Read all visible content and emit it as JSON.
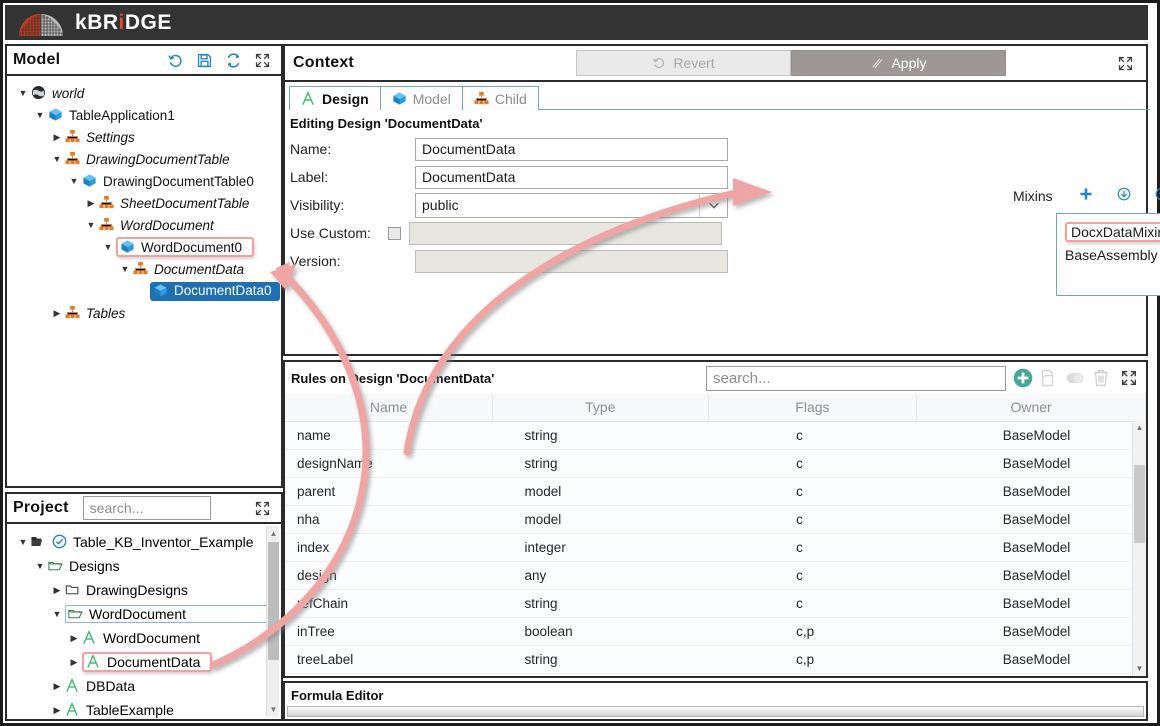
{
  "app": {
    "logo_text_1": "k",
    "logo_text_2": "BR",
    "logo_dot": "i",
    "logo_text_3": "DGE"
  },
  "model_panel": {
    "title": "Model",
    "icons": [
      "history-icon",
      "save-icon",
      "refresh-icon",
      "maximize-icon"
    ],
    "tree": [
      {
        "label": "world",
        "depth": 0,
        "twisty": "down",
        "icon": "globe-icon",
        "style": "italic",
        "state": "none"
      },
      {
        "label": "TableApplication1",
        "depth": 1,
        "twisty": "down",
        "icon": "cube-icon",
        "style": "normal",
        "state": "none"
      },
      {
        "label": "Settings",
        "depth": 2,
        "twisty": "right",
        "icon": "hierarchy-icon",
        "style": "italic",
        "state": "none"
      },
      {
        "label": "DrawingDocumentTable",
        "depth": 2,
        "twisty": "down",
        "icon": "hierarchy-icon",
        "style": "italic",
        "state": "none"
      },
      {
        "label": "DrawingDocumentTable0",
        "depth": 3,
        "twisty": "down",
        "icon": "cube-icon",
        "style": "normal",
        "state": "none"
      },
      {
        "label": "SheetDocumentTable",
        "depth": 4,
        "twisty": "right",
        "icon": "hierarchy-icon",
        "style": "italic",
        "state": "none"
      },
      {
        "label": "WordDocument",
        "depth": 4,
        "twisty": "down",
        "icon": "hierarchy-icon",
        "style": "italic",
        "state": "none"
      },
      {
        "label": "WordDocument0",
        "depth": 5,
        "twisty": "down",
        "icon": "cube-icon",
        "style": "normal",
        "state": "highlight-red"
      },
      {
        "label": "DocumentData",
        "depth": 6,
        "twisty": "down",
        "icon": "hierarchy-icon",
        "style": "italic",
        "state": "none"
      },
      {
        "label": "DocumentData0",
        "depth": 7,
        "twisty": "none",
        "icon": "cube-icon",
        "style": "normal",
        "state": "selected"
      },
      {
        "label": "Tables",
        "depth": 2,
        "twisty": "right",
        "icon": "hierarchy-icon",
        "style": "italic",
        "state": "none"
      }
    ]
  },
  "project_panel": {
    "title": "Project",
    "search_placeholder": "search...",
    "maximize_icon": "maximize-icon",
    "tree": [
      {
        "label": "Table_KB_Inventor_Example",
        "depth": 0,
        "twisty": "down",
        "icon": "folder-open-check-icon",
        "state": "none"
      },
      {
        "label": "Designs",
        "depth": 1,
        "twisty": "down",
        "icon": "folder-open-icon",
        "state": "none"
      },
      {
        "label": "DrawingDesigns",
        "depth": 2,
        "twisty": "right",
        "icon": "folder-icon",
        "state": "none"
      },
      {
        "label": "WordDocument",
        "depth": 2,
        "twisty": "down",
        "icon": "folder-open-icon",
        "state": "highlight-blue"
      },
      {
        "label": "WordDocument",
        "depth": 3,
        "twisty": "right",
        "icon": "design-a-icon",
        "state": "none"
      },
      {
        "label": "DocumentData",
        "depth": 3,
        "twisty": "right",
        "icon": "design-a-icon",
        "state": "highlight-red"
      },
      {
        "label": "DBData",
        "depth": 2,
        "twisty": "right",
        "icon": "design-a-icon",
        "state": "none"
      },
      {
        "label": "TableExample",
        "depth": 2,
        "twisty": "right",
        "icon": "design-a-icon",
        "state": "none"
      }
    ]
  },
  "context_panel": {
    "title": "Context",
    "revert_label": "Revert",
    "revert_icon": "revert-icon",
    "apply_label": "Apply",
    "apply_icon": "apply-icon",
    "maximize_icon": "maximize-icon",
    "tabs": [
      {
        "label": "Design",
        "icon": "design-a-icon",
        "active": true
      },
      {
        "label": "Model",
        "icon": "cube-icon",
        "active": false
      },
      {
        "label": "Child",
        "icon": "hierarchy-icon",
        "active": false
      }
    ],
    "editing_label": "Editing Design 'DocumentData'",
    "fields": [
      {
        "label": "Name:",
        "value": "DocumentData",
        "kind": "text",
        "disabled": false
      },
      {
        "label": "Label:",
        "value": "DocumentData",
        "kind": "text",
        "disabled": false
      },
      {
        "label": "Visibility:",
        "value": "public",
        "kind": "select",
        "disabled": false
      },
      {
        "label": "Use Custom:",
        "value": "",
        "kind": "checkbox",
        "disabled": true
      },
      {
        "label": "Version:",
        "value": "",
        "kind": "text",
        "disabled": true
      }
    ],
    "mixins": {
      "label": "Mixins",
      "buttons": [
        "plus-icon",
        "move-down-icon",
        "move-up-icon",
        "delete-x-icon"
      ],
      "items": [
        {
          "label": "DocxDataMixin",
          "state": "highlight-red"
        },
        {
          "label": "BaseAssembly",
          "state": "none"
        }
      ]
    }
  },
  "rules_panel": {
    "title": "Rules on Design 'DocumentData'",
    "search_placeholder": "search...",
    "icons": [
      "add-rule-icon",
      "copy-rule-icon",
      "toggle-icon",
      "delete-rule-icon",
      "maximize-icon"
    ],
    "columns": [
      "Name",
      "Type",
      "Flags",
      "Owner"
    ],
    "rows": [
      {
        "name": "name",
        "type": "string",
        "flags": "c",
        "owner": "BaseModel"
      },
      {
        "name": "designName",
        "type": "string",
        "flags": "c",
        "owner": "BaseModel"
      },
      {
        "name": "parent",
        "type": "model",
        "flags": "c",
        "owner": "BaseModel"
      },
      {
        "name": "nha",
        "type": "model",
        "flags": "c",
        "owner": "BaseModel"
      },
      {
        "name": "index",
        "type": "integer",
        "flags": "c",
        "owner": "BaseModel"
      },
      {
        "name": "design",
        "type": "any",
        "flags": "c",
        "owner": "BaseModel"
      },
      {
        "name": "refChain",
        "type": "string",
        "flags": "c",
        "owner": "BaseModel"
      },
      {
        "name": "inTree",
        "type": "boolean",
        "flags": "c,p",
        "owner": "BaseModel"
      },
      {
        "name": "treeLabel",
        "type": "string",
        "flags": "c,p",
        "owner": "BaseModel"
      }
    ]
  },
  "formula_panel": {
    "title": "Formula Editor"
  },
  "colors": {
    "accent_teal": "#6aada4",
    "highlight_red": "#f2a0a0",
    "selection_blue": "#1f6fb2",
    "icon_blue": "#2286c9",
    "arrow_pink": "#f0a5a5",
    "logo_orange": "#d94f2b"
  }
}
